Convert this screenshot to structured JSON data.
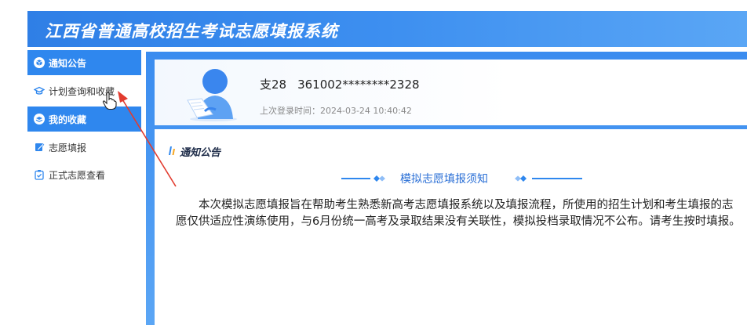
{
  "header": {
    "title": "江西省普通高校招生考试志愿填报系统"
  },
  "sidebar": {
    "items": [
      {
        "label": "通知公告",
        "icon": "box-icon",
        "active": true
      },
      {
        "label": "计划查询和收藏",
        "icon": "graduation-cap-icon",
        "active": false
      },
      {
        "label": "我的收藏",
        "icon": "layers-icon",
        "active": true
      },
      {
        "label": "志愿填报",
        "icon": "edit-icon",
        "active": false
      },
      {
        "label": "正式志愿查看",
        "icon": "check-clipboard-icon",
        "active": false
      }
    ]
  },
  "profile": {
    "name": "支28",
    "id_number": "361002********2328",
    "last_login": "上次登录时间：2024-03-24 10:40:42"
  },
  "notice": {
    "section_title": "通知公告",
    "subtitle": "模拟志愿填报须知",
    "body": "本次模拟志愿填报旨在帮助考生熟悉新高考志愿填报系统以及填报流程，所使用的招生计划和考生填报的志愿仅供适应性演练使用，与6月份统一高考及录取结果没有关联性，模拟投档录取情况不公布。请考生按时填报。"
  },
  "colors": {
    "primary": "#2f87ee",
    "header": "#3d8ff0",
    "annotation_arrow": "#e23b2e",
    "subtitle": "#2a6fd6"
  }
}
